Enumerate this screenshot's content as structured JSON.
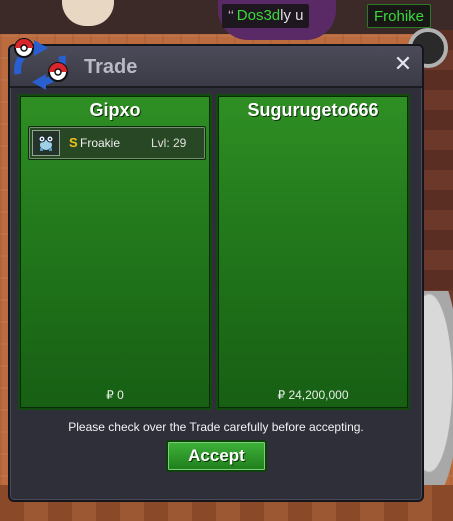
{
  "world": {
    "nameplates": [
      {
        "icons": "ʻʻ",
        "name": "Dos3d",
        "rest": "ly u",
        "name_color": "#39d939"
      },
      {
        "name": "Frohike",
        "name_color": "#39d939"
      }
    ]
  },
  "trade": {
    "title": "Trade",
    "close_label": "✕",
    "left": {
      "player": "Gipxo",
      "items": [
        {
          "shiny_marker": "S",
          "name": "Froakie",
          "level": "Lvl: 29"
        }
      ],
      "money": "₽ 0"
    },
    "right": {
      "player": "Sugurugeto666",
      "items": [],
      "money": "₽ 24,200,000"
    },
    "notice": "Please check over the Trade carefully before accepting.",
    "accept_label": "Accept"
  },
  "colors": {
    "panel_green": "#237a1c",
    "window_bg": "#2f2f3a",
    "accept_green": "#3fb23a",
    "shiny_gold": "#f0c020"
  },
  "icons": {
    "emblem": "trade-exchange-icon",
    "close": "close-icon",
    "item": "froakie-sprite-icon",
    "shiny": "shiny-star-icon"
  }
}
